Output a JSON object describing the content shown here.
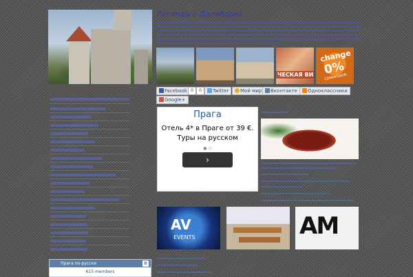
{
  "header": {
    "site_title": "Легенда о Далиборке"
  },
  "thumbs": {
    "visa_text": "ЧЕСКАЯ ВИЗА",
    "change_text": "change",
    "zero_text": "0%",
    "commission_text": "COMMISSION"
  },
  "share": {
    "facebook": "Facebook",
    "facebook_count": "0",
    "twitter_count": "0",
    "twitter": "Twitter",
    "moi_mir": "Мой мир",
    "vkontakte": "Вконтакте",
    "odnoklassniki": "Одноклассники",
    "google": "Google+"
  },
  "ad": {
    "title": "Прага",
    "text": "Отель 4* в Праге от 39 €. Туры на русском",
    "dots": "● ○",
    "button": "›"
  },
  "bottom": {
    "av": "AV",
    "events": "EVENTS",
    "am": "AM"
  },
  "vk_widget": {
    "title": "Прага по-русски",
    "logo": "В",
    "members": "615 members"
  },
  "colors": {
    "title": "#3a3aa8",
    "vk_header": "#5b7fa6"
  }
}
